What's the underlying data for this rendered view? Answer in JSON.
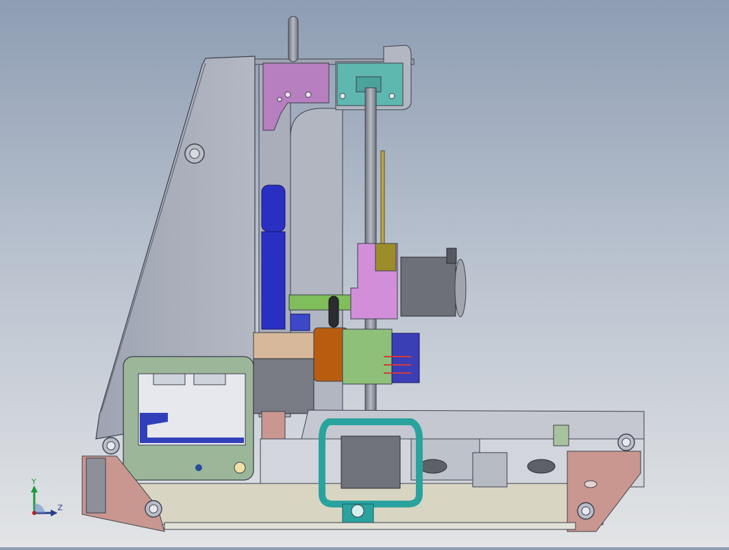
{
  "viewport": {
    "background_top": "#8e9db3",
    "background_bottom": "#e2e4e6",
    "model_outline_color": "#3a3f4a"
  },
  "triad": {
    "y_label": "Y",
    "z_label": "Z",
    "y_color": "#1a9a3a",
    "z_color": "#2a3d8a"
  },
  "parts": {
    "frame_color": "#a8adbb",
    "bracket_top_color": "#b77fbf",
    "bearing_mount_color": "#5fb8b0",
    "belt_color": "#2a2fc4",
    "carriage_color": "#b85d10",
    "tan_block_color": "#d7b89a",
    "green_block_color": "#8fc07a",
    "motor_color": "#6e7078",
    "electronics_box_color": "#9cb69a",
    "pink_bracket_color": "#d28ed8",
    "teal_frame_color": "#2aa39e",
    "rose_plate_color": "#c99790"
  }
}
